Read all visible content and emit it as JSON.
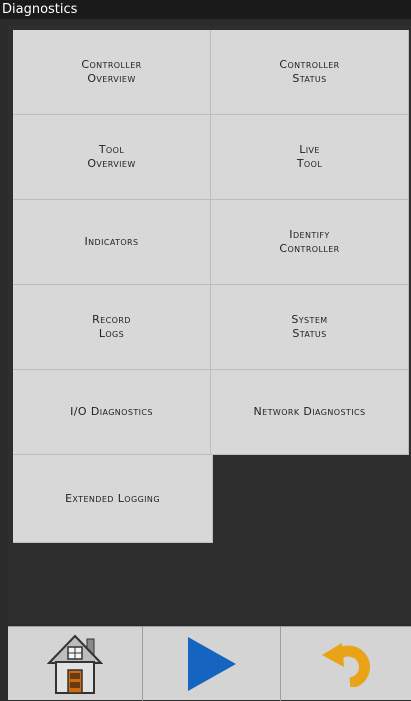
{
  "window": {
    "title": "Diagnostics"
  },
  "tiles": [
    {
      "line1": "Controller",
      "line2": "Overview"
    },
    {
      "line1": "Controller",
      "line2": "Status"
    },
    {
      "line1": "Tool",
      "line2": "Overview"
    },
    {
      "line1": "Live",
      "line2": "Tool"
    },
    {
      "line1": "Indicators",
      "line2": ""
    },
    {
      "line1": "Identify",
      "line2": "Controller"
    },
    {
      "line1": "Record",
      "line2": "Logs"
    },
    {
      "line1": "System",
      "line2": "Status"
    },
    {
      "line1": "I/O Diagnostics",
      "line2": ""
    },
    {
      "line1": "Network Diagnostics",
      "line2": ""
    },
    {
      "line1": "Extended Logging",
      "line2": ""
    }
  ],
  "bottom_bar": {
    "buttons": [
      {
        "icon": "home-icon"
      },
      {
        "icon": "play-icon"
      },
      {
        "icon": "undo-icon"
      }
    ]
  },
  "colors": {
    "background": "#2b2b2b",
    "tile": "#d8d8d8",
    "play": "#1565c0",
    "undo": "#e8a317"
  }
}
